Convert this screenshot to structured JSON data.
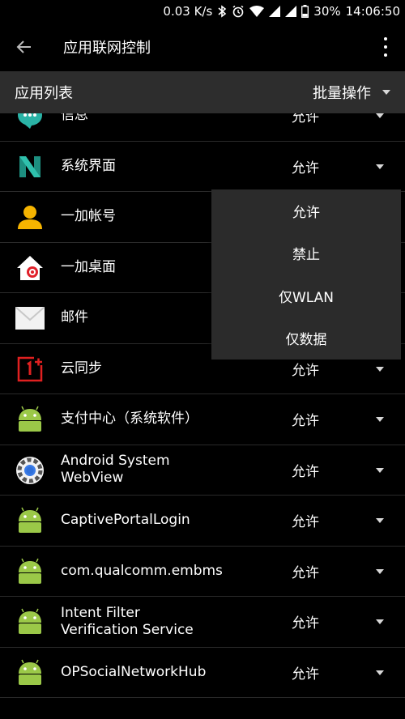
{
  "status": {
    "speed": "0.03 K/s",
    "battery": "30%",
    "time": "14:06:50"
  },
  "appbar": {
    "title": "应用联网控制"
  },
  "list_header": {
    "label": "应用列表",
    "batch": "批量操作"
  },
  "apps": [
    {
      "name": "信息",
      "permission": "允许",
      "icon": "messages-icon"
    },
    {
      "name": "系统界面",
      "permission": "允许",
      "icon": "nexus-icon"
    },
    {
      "name": "一加帐号",
      "permission": "",
      "icon": "account-icon"
    },
    {
      "name": "一加桌面",
      "permission": "",
      "icon": "launcher-icon"
    },
    {
      "name": "邮件",
      "permission": "",
      "icon": "mail-icon"
    },
    {
      "name": "云同步",
      "permission": "允许",
      "icon": "oneplus-cloud-icon"
    },
    {
      "name": "支付中心（系统软件）",
      "permission": "允许",
      "icon": "android-icon"
    },
    {
      "name": "Android System WebView",
      "permission": "允许",
      "icon": "webview-icon"
    },
    {
      "name": "CaptivePortalLogin",
      "permission": "允许",
      "icon": "android-icon"
    },
    {
      "name": "com.qualcomm.embms",
      "permission": "允许",
      "icon": "android-icon"
    },
    {
      "name": "Intent Filter Verification Service",
      "permission": "允许",
      "icon": "android-icon"
    },
    {
      "name": "OPSocialNetworkHub",
      "permission": "允许",
      "icon": "android-icon"
    }
  ],
  "dropdown": [
    "允许",
    "禁止",
    "仅WLAN",
    "仅数据"
  ],
  "colors": {
    "background": "#000000",
    "header": "#2d2d2d",
    "menu": "#2b2b2b",
    "android_green": "#9bc848"
  }
}
